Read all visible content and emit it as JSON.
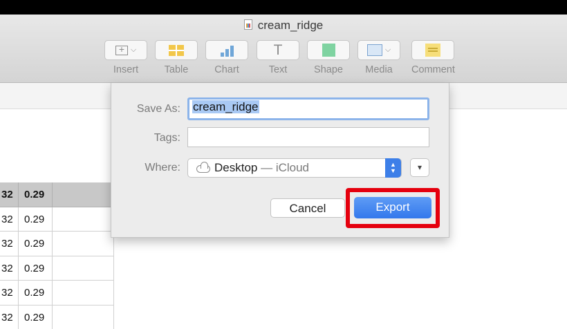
{
  "window": {
    "title": "cream_ridge"
  },
  "toolbar": {
    "insert": "Insert",
    "table": "Table",
    "chart": "Chart",
    "text": "Text",
    "text_glyph": "T",
    "shape": "Shape",
    "media": "Media",
    "comment": "Comment"
  },
  "sheet": {
    "header": [
      "32",
      "0.29",
      ""
    ],
    "rows": [
      [
        "32",
        "0.29",
        ""
      ],
      [
        "32",
        "0.29",
        ""
      ],
      [
        "32",
        "0.29",
        ""
      ],
      [
        "32",
        "0.29",
        ""
      ],
      [
        "32",
        "0.29",
        ""
      ]
    ]
  },
  "dialog": {
    "save_as_label": "Save As:",
    "save_as_value": "cream_ridge",
    "tags_label": "Tags:",
    "tags_value": "",
    "where_label": "Where:",
    "where_location": "Desktop",
    "where_service": " — iCloud",
    "cancel": "Cancel",
    "export": "Export"
  },
  "colors": {
    "accent": "#3d7fe8",
    "highlight_border": "#e5000e",
    "selection": "#a9c9f4"
  }
}
